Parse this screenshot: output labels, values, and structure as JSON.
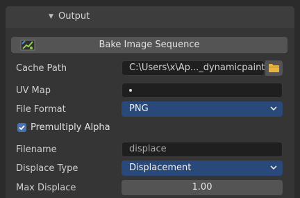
{
  "panel": {
    "title": "Output"
  },
  "bake": {
    "label": "Bake Image Sequence",
    "icon": "bake-icon"
  },
  "cache_path": {
    "label": "Cache Path",
    "value": "C:\\Users\\x\\Ap..._dynamicpaint",
    "icon": "folder-icon"
  },
  "uv_map": {
    "label": "UV Map",
    "value": ""
  },
  "file_format": {
    "label": "File Format",
    "value": "PNG"
  },
  "premultiply": {
    "label": "Premultiply Alpha",
    "checked": true
  },
  "filename": {
    "label": "Filename",
    "value": "displace"
  },
  "displace_type": {
    "label": "Displace Type",
    "value": "Displacement"
  },
  "max_displace": {
    "label": "Max Displace",
    "value": "1.00"
  },
  "colors": {
    "panel_bg": "#353535",
    "accent": "#4772b3",
    "dropdown": "#29497a",
    "folder": "#e8b43c"
  }
}
